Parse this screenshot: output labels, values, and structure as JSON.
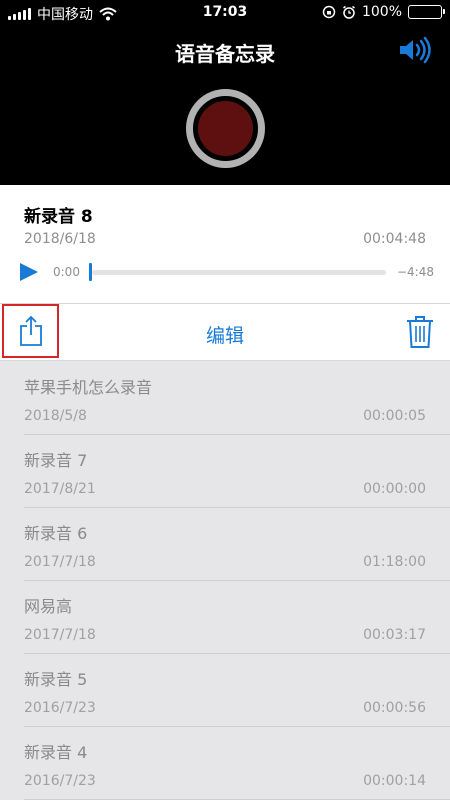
{
  "status": {
    "carrier": "中国移动",
    "time": "17:03",
    "battery": "100%",
    "battery_level": 1.0
  },
  "header": {
    "title": "语音备忘录"
  },
  "selected": {
    "name": "新录音 8",
    "date": "2018/6/18",
    "duration": "00:04:48",
    "elapsed": "0:00",
    "remaining": "−4:48",
    "progress": 0.0
  },
  "toolbar": {
    "edit_label": "编辑"
  },
  "recordings": [
    {
      "name": "苹果手机怎么录音",
      "date": "2018/5/8",
      "duration": "00:00:05"
    },
    {
      "name": "新录音 7",
      "date": "2017/8/21",
      "duration": "00:00:00"
    },
    {
      "name": "新录音 6",
      "date": "2017/7/18",
      "duration": "01:18:00"
    },
    {
      "name": "网易高",
      "date": "2017/7/18",
      "duration": "00:03:17"
    },
    {
      "name": "新录音 5",
      "date": "2016/7/23",
      "duration": "00:00:56"
    },
    {
      "name": "新录音 4",
      "date": "2016/7/23",
      "duration": "00:00:14"
    }
  ],
  "colors": {
    "accent": "#1a7bd6",
    "record": "#5e1010",
    "highlight": "#d42828"
  },
  "icons": {
    "signal": "signal-icon",
    "wifi": "wifi-icon",
    "lock_rotation": "rotation-lock-icon",
    "alarm": "alarm-icon",
    "speaker": "speaker-icon",
    "play": "play-icon",
    "share": "share-icon",
    "trash": "trash-icon"
  }
}
